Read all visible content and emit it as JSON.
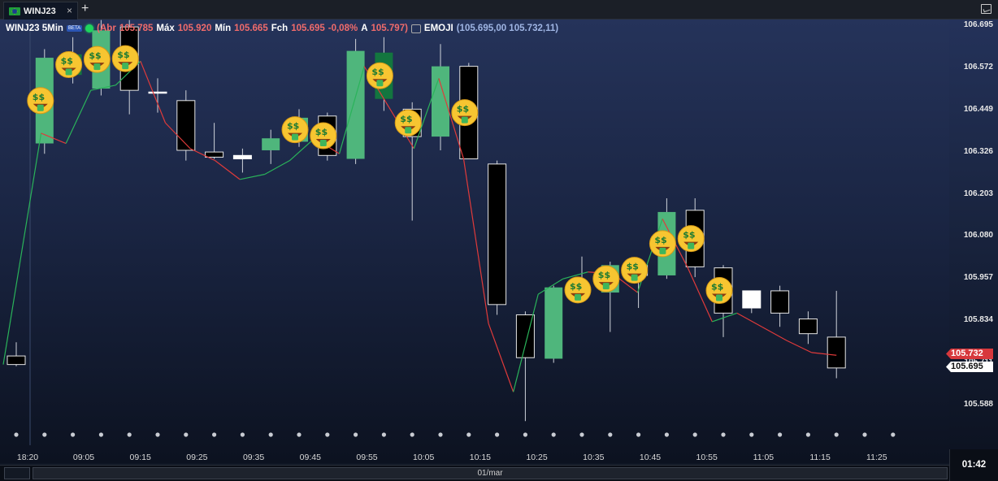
{
  "tab": {
    "label": "WINJ23",
    "close": "×",
    "add": "+"
  },
  "legend": {
    "symbol": "WINJ23 5Min",
    "beta": "BETA",
    "open_label": "(Abr",
    "open": "105.785",
    "high_label": "Máx",
    "high": "105.920",
    "low_label": "Mín",
    "low": "105.665",
    "close_label": "Fch",
    "close": "105.695",
    "change": "-0,08%",
    "a_label": "A",
    "a_value": "105.797)",
    "indicator_name": "EMOJI",
    "indicator_values": "(105.695,00 105.732,11)"
  },
  "price_tags": {
    "red": "105.732",
    "white": "105.695"
  },
  "bottom": {
    "date": "01/mar",
    "clock": "01:42"
  },
  "colors": {
    "bull": "#4fb67c",
    "bull_dark": "#13763f",
    "bear": "#000000",
    "line_up": "#2ab35a",
    "line_down": "#e03a3a"
  },
  "chart_data": {
    "type": "candlestick",
    "title": "",
    "y_ticks": [
      "106.695",
      "106.572",
      "106.449",
      "106.326",
      "106.203",
      "106.080",
      "105.957",
      "105.834",
      "105.711",
      "105.588"
    ],
    "ylim": [
      105.52,
      106.695
    ],
    "x_ticks": [
      "18:20",
      "09:05",
      "09:15",
      "09:25",
      "09:35",
      "09:45",
      "09:55",
      "10:05",
      "10:15",
      "10:25",
      "10:35",
      "10:45",
      "10:55",
      "11:05",
      "11:15",
      "11:25"
    ],
    "grid": false,
    "candles": [
      {
        "o": 105.705,
        "c": 105.73,
        "h": 105.77,
        "l": 105.7,
        "fill": "black"
      },
      {
        "o": 106.35,
        "c": 106.6,
        "h": 106.625,
        "l": 106.32,
        "fill": "bull"
      },
      {
        "o": 106.55,
        "c": 106.61,
        "h": 106.66,
        "l": 106.525,
        "fill": "bull_dark"
      },
      {
        "o": 106.51,
        "c": 106.68,
        "h": 106.71,
        "l": 106.49,
        "fill": "bull"
      },
      {
        "o": 106.69,
        "c": 106.505,
        "h": 106.71,
        "l": 106.435,
        "fill": "black"
      },
      {
        "o": 106.5,
        "c": 106.5,
        "h": 106.54,
        "l": 106.44,
        "fill": "doji"
      },
      {
        "o": 106.475,
        "c": 106.33,
        "h": 106.505,
        "l": 106.3,
        "fill": "black"
      },
      {
        "o": 106.325,
        "c": 106.31,
        "h": 106.41,
        "l": 106.305,
        "fill": "black"
      },
      {
        "o": 106.305,
        "c": 106.315,
        "h": 106.335,
        "l": 106.265,
        "fill": "white"
      },
      {
        "o": 106.33,
        "c": 106.365,
        "h": 106.39,
        "l": 106.29,
        "fill": "bull"
      },
      {
        "o": 106.355,
        "c": 106.425,
        "h": 106.45,
        "l": 106.34,
        "fill": "bull"
      },
      {
        "o": 106.43,
        "c": 106.315,
        "h": 106.44,
        "l": 106.3,
        "fill": "black"
      },
      {
        "o": 106.305,
        "c": 106.62,
        "h": 106.655,
        "l": 106.29,
        "fill": "bull"
      },
      {
        "o": 106.48,
        "c": 106.615,
        "h": 106.66,
        "l": 106.445,
        "fill": "bull_dark"
      },
      {
        "o": 106.45,
        "c": 106.37,
        "h": 106.47,
        "l": 106.125,
        "fill": "black"
      },
      {
        "o": 106.37,
        "c": 106.575,
        "h": 106.64,
        "l": 106.33,
        "fill": "bull"
      },
      {
        "o": 106.575,
        "c": 106.305,
        "h": 106.585,
        "l": 106.305,
        "fill": "black"
      },
      {
        "o": 106.29,
        "c": 105.88,
        "h": 106.3,
        "l": 105.85,
        "fill": "black"
      },
      {
        "o": 105.85,
        "c": 105.725,
        "h": 105.86,
        "l": 105.54,
        "fill": "black"
      },
      {
        "o": 105.722,
        "c": 105.93,
        "h": 105.935,
        "l": 105.71,
        "fill": "bull"
      },
      {
        "o": 105.93,
        "c": 105.915,
        "h": 106.02,
        "l": 105.9,
        "fill": "bull"
      },
      {
        "o": 105.915,
        "c": 105.995,
        "h": 106.005,
        "l": 105.8,
        "fill": "bull"
      },
      {
        "o": 105.995,
        "c": 105.965,
        "h": 106.0,
        "l": 105.87,
        "fill": "black"
      },
      {
        "o": 105.965,
        "c": 106.15,
        "h": 106.19,
        "l": 105.955,
        "fill": "bull"
      },
      {
        "o": 106.155,
        "c": 105.99,
        "h": 106.19,
        "l": 105.96,
        "fill": "black"
      },
      {
        "o": 105.987,
        "c": 105.855,
        "h": 105.995,
        "l": 105.785,
        "fill": "black"
      },
      {
        "o": 105.87,
        "c": 105.92,
        "h": 105.92,
        "l": 105.855,
        "fill": "white"
      },
      {
        "o": 105.92,
        "c": 105.855,
        "h": 105.935,
        "l": 105.815,
        "fill": "black"
      },
      {
        "o": 105.838,
        "c": 105.795,
        "h": 105.86,
        "l": 105.765,
        "fill": "black"
      },
      {
        "o": 105.785,
        "c": 105.695,
        "h": 105.92,
        "l": 105.665,
        "fill": "black"
      }
    ],
    "indicator_line": [
      105.705,
      106.38,
      106.35,
      106.505,
      106.52,
      106.59,
      106.41,
      106.335,
      106.3,
      106.245,
      106.26,
      106.3,
      106.365,
      106.32,
      106.575,
      106.455,
      106.335,
      106.54,
      106.305,
      105.825,
      105.625,
      105.91,
      105.955,
      105.975,
      105.97,
      105.915,
      106.13,
      105.99,
      105.83,
      105.855,
      105.815,
      105.775,
      105.74,
      105.732
    ],
    "emoji_markers": [
      1,
      2,
      3,
      4,
      10,
      11,
      13,
      14,
      16,
      20,
      21,
      22,
      23,
      24,
      25
    ]
  }
}
